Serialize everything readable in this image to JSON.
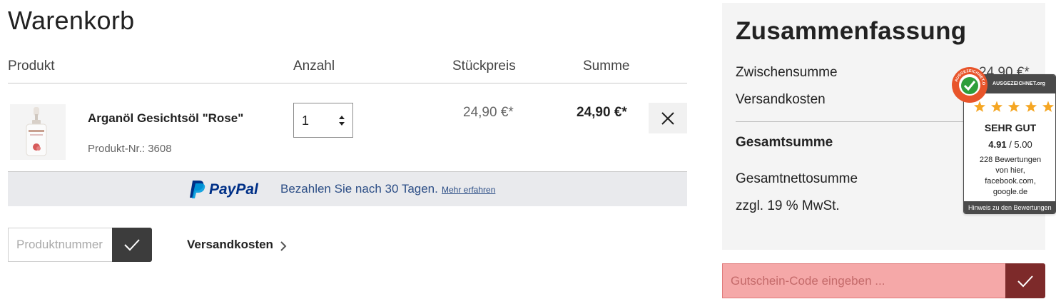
{
  "cart": {
    "title": "Warenkorb",
    "columns": {
      "product": "Produkt",
      "quantity": "Anzahl",
      "unit_price": "Stückpreis",
      "total": "Summe"
    },
    "items": [
      {
        "name": "Arganöl Gesichtsöl \"Rose\"",
        "product_number": "Produkt-Nr.: 3608",
        "quantity": "1",
        "unit_price": "24,90 €*",
        "total": "24,90 €*"
      }
    ]
  },
  "paypal": {
    "logo_text": "PayPal",
    "message": "Bezahlen Sie nach 30 Tagen.",
    "link": "Mehr erfahren"
  },
  "product_number_input": {
    "placeholder": "Produktnummer"
  },
  "shipping_link": "Versandkosten",
  "summary": {
    "title": "Zusammenfassung",
    "subtotal_label": "Zwischensumme",
    "subtotal_value": "24,90 €*",
    "shipping_label": "Versandkosten",
    "grand_total_label": "Gesamtsumme",
    "net_total_label": "Gesamtnettosumme",
    "vat_label": "zzgl. 19 % MwSt."
  },
  "coupon": {
    "placeholder": "Gutschein-Code eingeben ..."
  },
  "rating_widget": {
    "brand": "AUSGEZEICHNET.org",
    "seal_text": "AUSGEZEICHNET.ORG",
    "stars": 5,
    "verdict": "SEHR GUT",
    "score": "4.91",
    "score_max": "/ 5.00",
    "reviews_line1": "228 Bewertungen",
    "reviews_line2": "von hier,",
    "reviews_line3": "facebook.com,",
    "reviews_line4": "google.de",
    "footer": "Hinweis zu den Bewertungen"
  },
  "colors": {
    "accent_dark": "#3c3c3c",
    "coupon_button": "#7d2a2a",
    "coupon_field": "#f5a8a8",
    "paypal_blue": "#003087",
    "paypal_light_blue": "#009cde",
    "star_orange": "#f5a623",
    "seal_orange": "#e8542a",
    "seal_green": "#2e9e3a"
  },
  "icons": {
    "remove": "close-icon",
    "quantity": "up-down-arrows-icon",
    "confirm": "checkmark-icon",
    "shipping": "chevron-right-icon",
    "rating": "star-icon"
  }
}
